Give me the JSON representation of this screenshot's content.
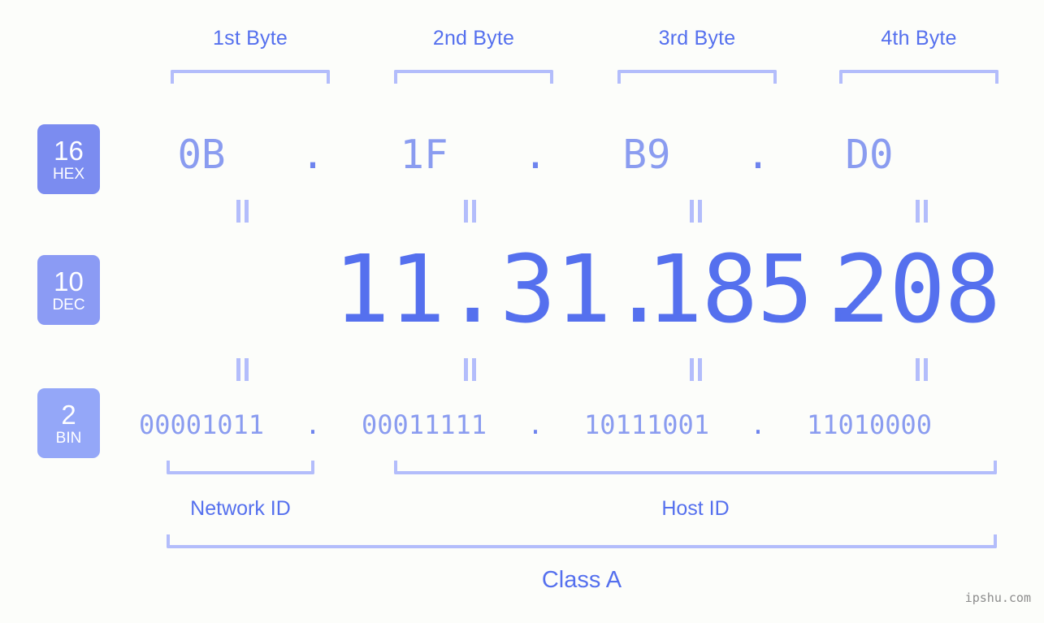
{
  "meta": {
    "background_color": "#fcfdfa",
    "accent_strong": "#5570ee",
    "accent_light": "#8a9cf0",
    "accent_bracket": "#b3bdfb",
    "watermark": "ipshu.com"
  },
  "byte_headers": [
    {
      "label": "1st Byte"
    },
    {
      "label": "2nd Byte"
    },
    {
      "label": "3rd Byte"
    },
    {
      "label": "4th Byte"
    }
  ],
  "bases": [
    {
      "id": "hex",
      "number": "16",
      "name": "HEX",
      "color": "#7b8cf0"
    },
    {
      "id": "dec",
      "number": "10",
      "name": "DEC",
      "color": "#8b9bf4"
    },
    {
      "id": "bin",
      "number": "2",
      "name": "BIN",
      "color": "#94a7f8"
    }
  ],
  "separator": ".",
  "rows": {
    "hex": {
      "octets": [
        "0B",
        "1F",
        "B9",
        "D0"
      ]
    },
    "dec": {
      "octets": [
        "11",
        "31",
        "185",
        "208"
      ]
    },
    "bin": {
      "octets": [
        "00001011",
        "00011111",
        "10111001",
        "11010000"
      ]
    }
  },
  "equals_glyph": "=",
  "segments": [
    {
      "id": "network",
      "label": "Network ID"
    },
    {
      "id": "host",
      "label": "Host ID"
    }
  ],
  "class": {
    "label": "Class A"
  }
}
